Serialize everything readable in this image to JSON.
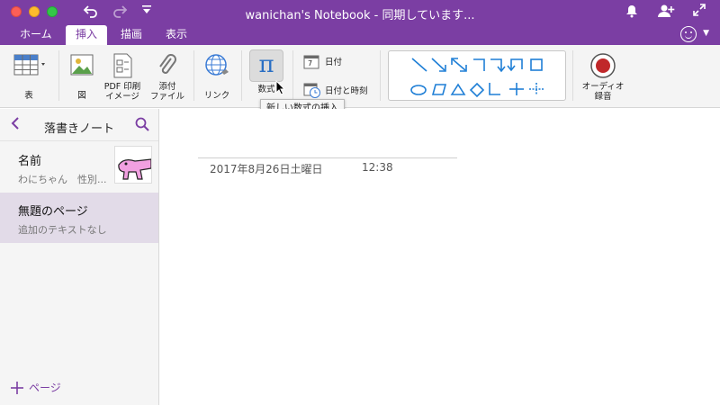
{
  "window": {
    "title": "wanichan's Notebook - 同期しています..."
  },
  "tabs": [
    {
      "label": "ホーム",
      "active": false
    },
    {
      "label": "挿入",
      "active": true
    },
    {
      "label": "描画",
      "active": false
    },
    {
      "label": "表示",
      "active": false
    }
  ],
  "ribbon": {
    "table_label": "表",
    "picture_label": "図",
    "pdf_label_1": "PDF 印刷",
    "pdf_label_2": "イメージ",
    "attach_label_1": "添付",
    "attach_label_2": "ファイル",
    "link_label": "リンク",
    "math_label": "数式",
    "math_symbol": "π",
    "date_label": "日付",
    "datetime_label": "日付と時刻",
    "calendar_day": "7",
    "audio_label_1": "オーディオ",
    "audio_label_2": "録音",
    "tooltip": "新しい数式の挿入"
  },
  "sidebar": {
    "section_title": "落書きノート",
    "pages": [
      {
        "title": "名前",
        "preview": "わにちゃん　性別..."
      },
      {
        "title": "無題のページ",
        "preview": "追加のテキストなし"
      }
    ],
    "add_page_label": "ページ"
  },
  "note": {
    "date": "2017年8月26日土曜日",
    "time": "12:38"
  },
  "colors": {
    "accent": "#7b3ea3",
    "shape_blue": "#1f7fd6",
    "record_red": "#c0282a"
  }
}
